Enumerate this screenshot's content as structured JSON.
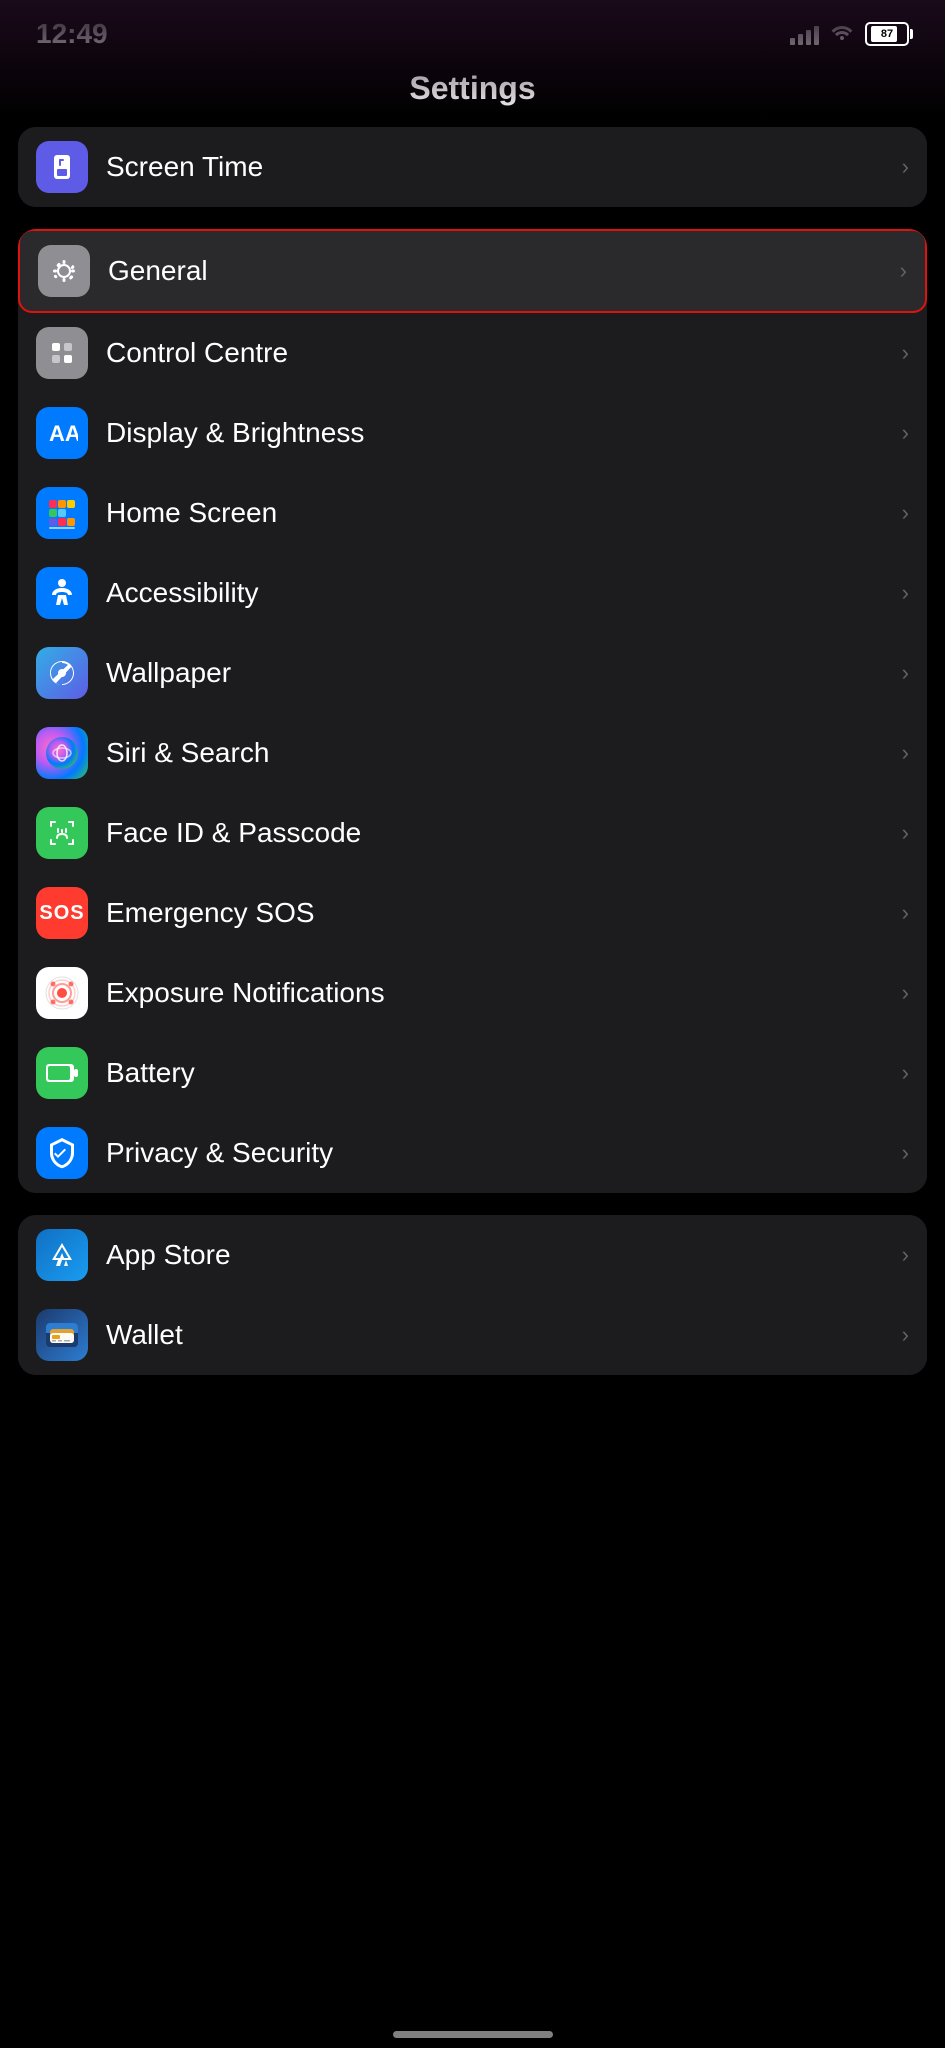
{
  "statusBar": {
    "time": "12:49",
    "batteryPercent": "87"
  },
  "header": {
    "title": "Settings"
  },
  "section1": {
    "items": [
      {
        "id": "screen-time",
        "label": "Screen Time",
        "iconType": "purple",
        "iconSymbol": "hourglass"
      }
    ]
  },
  "section2": {
    "items": [
      {
        "id": "general",
        "label": "General",
        "iconType": "gray",
        "iconSymbol": "gear",
        "highlighted": true
      },
      {
        "id": "control-centre",
        "label": "Control Centre",
        "iconType": "gray",
        "iconSymbol": "toggles"
      },
      {
        "id": "display-brightness",
        "label": "Display & Brightness",
        "iconType": "blue",
        "iconSymbol": "AA"
      },
      {
        "id": "home-screen",
        "label": "Home Screen",
        "iconType": "blue",
        "iconSymbol": "grid"
      },
      {
        "id": "accessibility",
        "label": "Accessibility",
        "iconType": "blue",
        "iconSymbol": "person-circle"
      },
      {
        "id": "wallpaper",
        "label": "Wallpaper",
        "iconType": "teal-purple",
        "iconSymbol": "flower"
      },
      {
        "id": "siri-search",
        "label": "Siri & Search",
        "iconType": "siri",
        "iconSymbol": "siri"
      },
      {
        "id": "face-id-passcode",
        "label": "Face ID & Passcode",
        "iconType": "green",
        "iconSymbol": "face-id"
      },
      {
        "id": "emergency-sos",
        "label": "Emergency SOS",
        "iconType": "red",
        "iconSymbol": "SOS"
      },
      {
        "id": "exposure-notifications",
        "label": "Exposure Notifications",
        "iconType": "white",
        "iconSymbol": "exposure"
      },
      {
        "id": "battery",
        "label": "Battery",
        "iconType": "green",
        "iconSymbol": "battery"
      },
      {
        "id": "privacy-security",
        "label": "Privacy & Security",
        "iconType": "blue",
        "iconSymbol": "hand"
      }
    ]
  },
  "section3": {
    "items": [
      {
        "id": "app-store",
        "label": "App Store",
        "iconType": "blue",
        "iconSymbol": "app-store"
      },
      {
        "id": "wallet",
        "label": "Wallet",
        "iconType": "wallet",
        "iconSymbol": "wallet"
      }
    ]
  },
  "chevron": "›",
  "homeIndicator": true
}
